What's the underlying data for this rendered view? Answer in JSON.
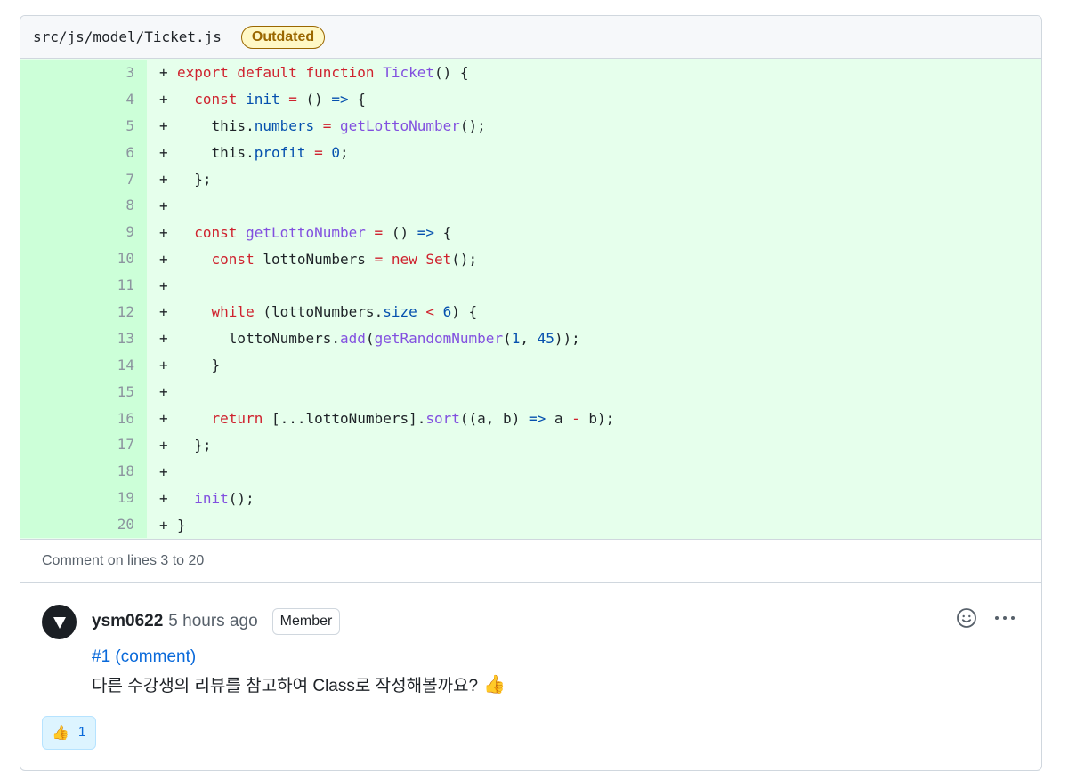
{
  "file": {
    "path": "src/js/model/Ticket.js",
    "status_badge": "Outdated"
  },
  "code_lines": [
    {
      "n": "3",
      "sign": "+",
      "parts": [
        [
          "k",
          "export default function "
        ],
        [
          "f",
          "Ticket"
        ],
        [
          "",
          "() {"
        ]
      ]
    },
    {
      "n": "4",
      "sign": "+",
      "parts": [
        [
          "",
          "  "
        ],
        [
          "k",
          "const "
        ],
        [
          "c",
          "init"
        ],
        [
          "k",
          " = "
        ],
        [
          "",
          "() "
        ],
        [
          "c",
          "=>"
        ],
        [
          "",
          " {"
        ]
      ]
    },
    {
      "n": "5",
      "sign": "+",
      "parts": [
        [
          "",
          "    this."
        ],
        [
          "c",
          "numbers"
        ],
        [
          "k",
          " = "
        ],
        [
          "f",
          "getLottoNumber"
        ],
        [
          "",
          "();"
        ]
      ]
    },
    {
      "n": "6",
      "sign": "+",
      "parts": [
        [
          "",
          "    this."
        ],
        [
          "c",
          "profit"
        ],
        [
          "k",
          " = "
        ],
        [
          "c",
          "0"
        ],
        [
          "",
          ";"
        ]
      ]
    },
    {
      "n": "7",
      "sign": "+",
      "parts": [
        [
          "",
          "  };"
        ]
      ]
    },
    {
      "n": "8",
      "sign": "+",
      "parts": [
        [
          "",
          ""
        ]
      ]
    },
    {
      "n": "9",
      "sign": "+",
      "parts": [
        [
          "",
          "  "
        ],
        [
          "k",
          "const "
        ],
        [
          "f",
          "getLottoNumber"
        ],
        [
          "k",
          " = "
        ],
        [
          "",
          "() "
        ],
        [
          "c",
          "=>"
        ],
        [
          "",
          " {"
        ]
      ]
    },
    {
      "n": "10",
      "sign": "+",
      "parts": [
        [
          "",
          "    "
        ],
        [
          "k",
          "const "
        ],
        [
          "",
          "lottoNumbers "
        ],
        [
          "k",
          "= new "
        ],
        [
          "k",
          "Set"
        ],
        [
          "",
          "();"
        ]
      ]
    },
    {
      "n": "11",
      "sign": "+",
      "parts": [
        [
          "",
          ""
        ]
      ]
    },
    {
      "n": "12",
      "sign": "+",
      "parts": [
        [
          "",
          "    "
        ],
        [
          "k",
          "while"
        ],
        [
          "",
          " (lottoNumbers."
        ],
        [
          "c",
          "size"
        ],
        [
          "k",
          " < "
        ],
        [
          "c",
          "6"
        ],
        [
          "",
          ") {"
        ]
      ]
    },
    {
      "n": "13",
      "sign": "+",
      "parts": [
        [
          "",
          "      lottoNumbers."
        ],
        [
          "f",
          "add"
        ],
        [
          "",
          "("
        ],
        [
          "f",
          "getRandomNumber"
        ],
        [
          "",
          "("
        ],
        [
          "c",
          "1"
        ],
        [
          "",
          ", "
        ],
        [
          "c",
          "45"
        ],
        [
          "",
          "));"
        ]
      ]
    },
    {
      "n": "14",
      "sign": "+",
      "parts": [
        [
          "",
          "    }"
        ]
      ]
    },
    {
      "n": "15",
      "sign": "+",
      "parts": [
        [
          "",
          ""
        ]
      ]
    },
    {
      "n": "16",
      "sign": "+",
      "parts": [
        [
          "",
          "    "
        ],
        [
          "k",
          "return"
        ],
        [
          "",
          " [...lottoNumbers]."
        ],
        [
          "f",
          "sort"
        ],
        [
          "",
          "((a, b) "
        ],
        [
          "c",
          "=>"
        ],
        [
          "",
          " a "
        ],
        [
          "k",
          "-"
        ],
        [
          "",
          " b);"
        ]
      ]
    },
    {
      "n": "17",
      "sign": "+",
      "parts": [
        [
          "",
          "  };"
        ]
      ]
    },
    {
      "n": "18",
      "sign": "+",
      "parts": [
        [
          "",
          ""
        ]
      ]
    },
    {
      "n": "19",
      "sign": "+",
      "parts": [
        [
          "",
          "  "
        ],
        [
          "f",
          "init"
        ],
        [
          "",
          "();"
        ]
      ]
    },
    {
      "n": "20",
      "sign": "+",
      "parts": [
        [
          "",
          "}"
        ]
      ]
    }
  ],
  "comment_range": "Comment on lines 3 to 20",
  "comment": {
    "author": "ysm0622",
    "time": "5 hours ago",
    "role": "Member",
    "ref": "#1 (comment)",
    "text": "다른 수강생의 리뷰를 참고하여 Class로 작성해볼까요?",
    "inline_emoji": "👍",
    "reaction_emoji": "👍",
    "reaction_count": "1"
  },
  "icons": {
    "avatar": "triangle-down-icon",
    "emoji_picker": "smiley-icon",
    "more": "kebab-horizontal-icon"
  }
}
